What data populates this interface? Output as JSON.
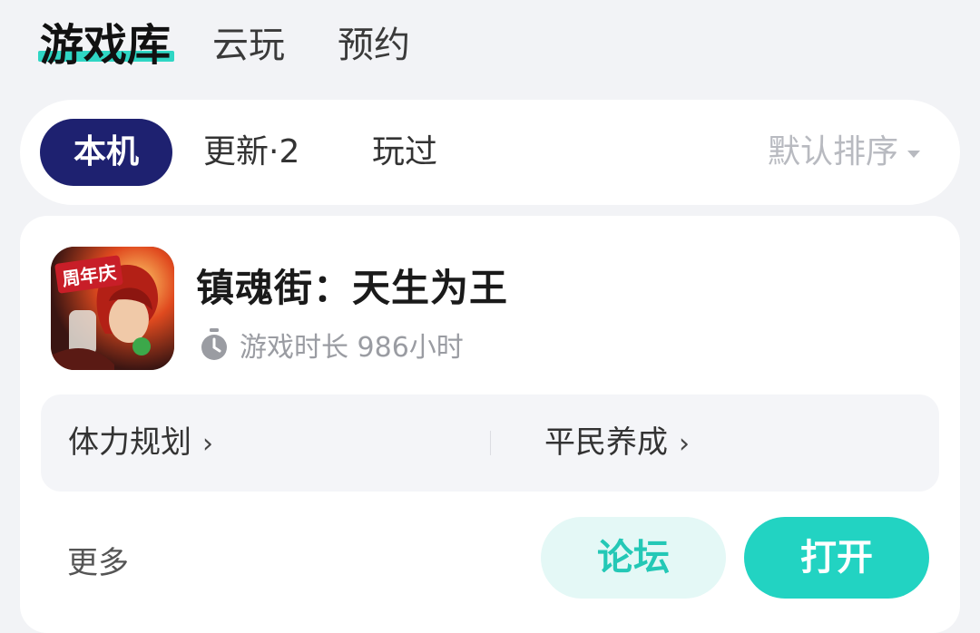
{
  "top_tabs": [
    {
      "label": "游戏库",
      "active": true
    },
    {
      "label": "云玩",
      "active": false
    },
    {
      "label": "预约",
      "active": false
    }
  ],
  "filter": {
    "chips": [
      {
        "label": "本机",
        "active": true
      },
      {
        "label": "更新·2",
        "active": false
      },
      {
        "label": "玩过",
        "active": false
      }
    ],
    "sort_label": "默认排序"
  },
  "game": {
    "icon_badge": "周年庆",
    "title": "镇魂街：天生为王",
    "playtime": "游戏时长 986小时",
    "guides": [
      {
        "label": "体力规划"
      },
      {
        "label": "平民养成"
      }
    ],
    "more_label": "更多",
    "forum_label": "论坛",
    "open_label": "打开"
  },
  "colors": {
    "accent": "#22d3c2",
    "active_chip": "#1e2170",
    "background": "#f2f3f6"
  },
  "icons": {
    "playtime": "stopwatch-icon",
    "sort": "caret-down-icon",
    "guide": "chevron-right-icon"
  }
}
